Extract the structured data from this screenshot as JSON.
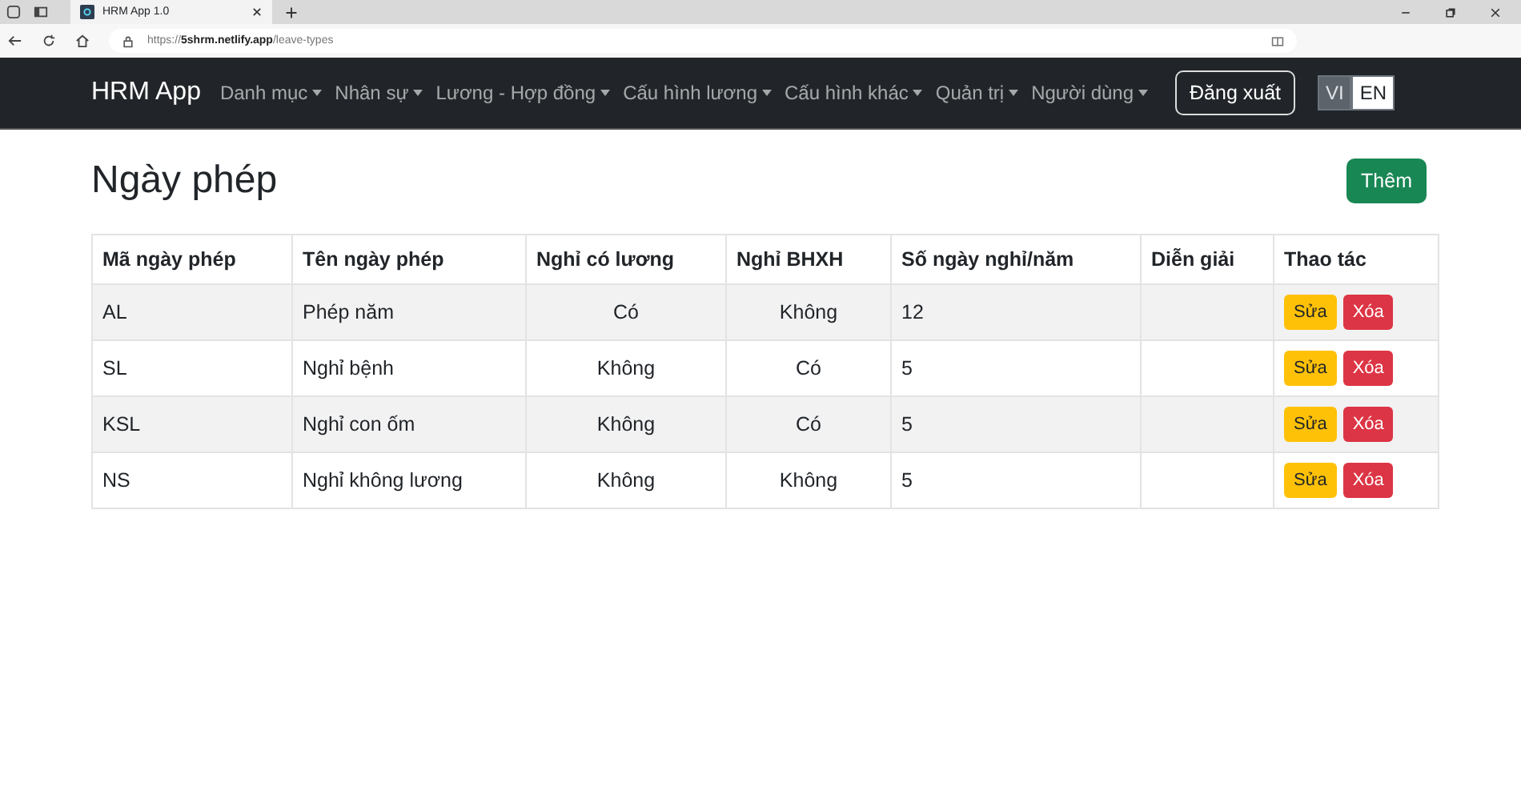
{
  "browser": {
    "tab_title": "HRM App 1.0",
    "url": "https://**5shrm.netlify.app**/leave-types"
  },
  "navbar": {
    "brand": "HRM App",
    "menus": [
      {
        "label": "Danh mục"
      },
      {
        "label": "Nhân sự"
      },
      {
        "label": "Lương - Hợp đồng"
      },
      {
        "label": "Cấu hình lương"
      },
      {
        "label": "Cấu hình khác"
      },
      {
        "label": "Quản trị"
      },
      {
        "label": "Người dùng"
      }
    ],
    "logout": "Đăng xuất",
    "languages": [
      {
        "label": "VI",
        "selected": false
      },
      {
        "label": "EN",
        "selected": true
      }
    ]
  },
  "page": {
    "title": "Ngày phép",
    "add_button": "Thêm"
  },
  "table": {
    "columns": [
      {
        "label": "Mã ngày phép"
      },
      {
        "label": "Tên ngày phép"
      },
      {
        "label": "Nghỉ có lương"
      },
      {
        "label": "Nghỉ BHXH"
      },
      {
        "label": "Số ngày nghỉ/năm"
      },
      {
        "label": "Diễn giải"
      },
      {
        "label": "Thao tác"
      }
    ],
    "rows": [
      {
        "cells": [
          "AL",
          "Phép năm",
          "Có",
          "Không",
          "12",
          ""
        ],
        "actions": [
          "Sửa",
          "Xóa"
        ]
      },
      {
        "cells": [
          "SL",
          "Nghỉ bệnh",
          "Không",
          "Có",
          "5",
          ""
        ],
        "actions": [
          "Sửa",
          "Xóa"
        ]
      },
      {
        "cells": [
          "KSL",
          "Nghỉ con ốm",
          "Không",
          "Có",
          "5",
          ""
        ],
        "actions": [
          "Sửa",
          "Xóa"
        ]
      },
      {
        "cells": [
          "NS",
          "Nghỉ không lương",
          "Không",
          "Không",
          "5",
          ""
        ],
        "actions": [
          "Sửa",
          "Xóa"
        ]
      }
    ]
  }
}
